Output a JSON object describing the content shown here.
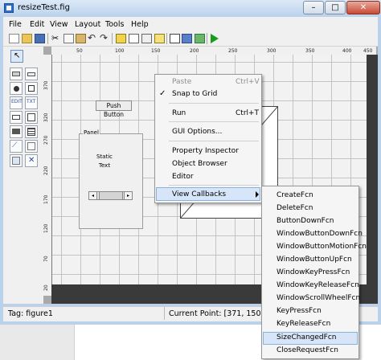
{
  "window": {
    "title": "resizeTest.fig",
    "controls": [
      "minimize",
      "maximize",
      "close"
    ]
  },
  "menubar": {
    "items": [
      "File",
      "Edit",
      "View",
      "Layout",
      "Tools",
      "Help"
    ]
  },
  "toolbar": {
    "icons": [
      "new-file-icon",
      "open-folder-icon",
      "save-icon",
      "cut-icon",
      "copy-icon",
      "paste-icon",
      "undo-icon",
      "redo-icon",
      "align-icon",
      "menu-editor-icon",
      "tab-order-icon",
      "toolbar-editor-icon",
      "m-file-editor-icon",
      "property-inspector-icon",
      "object-browser-icon",
      "run-icon"
    ]
  },
  "palette": {
    "items": [
      "select-tool-icon",
      "push-button-tool-icon",
      "slider-tool-icon",
      "radio-button-tool-icon",
      "checkbox-tool-icon",
      "edit-text-tool-icon",
      "static-text-tool-icon",
      "popup-menu-tool-icon",
      "listbox-tool-icon",
      "toggle-button-tool-icon",
      "table-tool-icon",
      "axes-tool-icon",
      "panel-tool-icon",
      "button-group-tool-icon",
      "activex-tool-icon"
    ]
  },
  "rulers": {
    "horizontal": [
      "50",
      "100",
      "150",
      "200",
      "250",
      "300",
      "350",
      "400",
      "450"
    ],
    "vertical": [
      "370",
      "320",
      "270",
      "220",
      "170",
      "120",
      "70",
      "20"
    ]
  },
  "canvas": {
    "push_button_label": "Push Button",
    "panel_title": "Panel",
    "static_text": "Static Text",
    "colors": {
      "grid": "#f2f2f2",
      "gridline": "#c3c3c3",
      "dark_border": "#3a3a3a"
    }
  },
  "context_menu": {
    "paste": "Paste",
    "paste_shortcut": "Ctrl+V",
    "snap_to_grid": "Snap to Grid",
    "snap_checked": true,
    "run": "Run",
    "run_shortcut": "Ctrl+T",
    "gui_options": "GUI Options...",
    "property_inspector": "Property Inspector",
    "object_browser": "Object Browser",
    "editor": "Editor",
    "view_callbacks": "View Callbacks"
  },
  "submenu": {
    "items": [
      "CreateFcn",
      "DeleteFcn",
      "ButtonDownFcn",
      "WindowButtonDownFcn",
      "WindowButtonMotionFcn",
      "WindowButtonUpFcn",
      "WindowKeyPressFcn",
      "WindowKeyReleaseFcn",
      "WindowScrollWheelFcn",
      "KeyPressFcn",
      "KeyReleaseFcn",
      "SizeChangedFcn",
      "CloseRequestFcn"
    ],
    "highlighted": "SizeChangedFcn"
  },
  "statusbar": {
    "tag": "Tag: figure1",
    "current_point": "Current Point:  [371, 150]"
  },
  "theme": {
    "highlight": "#d6e5f7",
    "highlight_border": "#8ab0dc",
    "close_button": "#c74a34",
    "run_green": "#1a9b1a"
  }
}
